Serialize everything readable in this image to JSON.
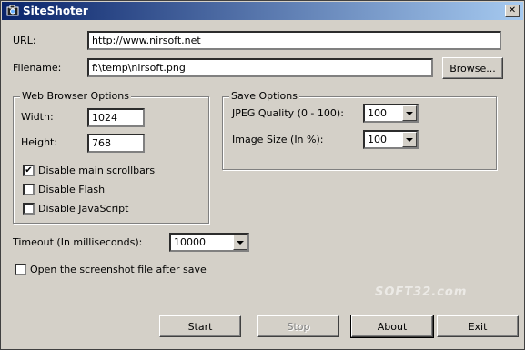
{
  "window": {
    "title": "SiteShoter",
    "close_glyph": "✕"
  },
  "url": {
    "label": "URL:",
    "value": "http://www.nirsoft.net"
  },
  "filename": {
    "label": "Filename:",
    "value": "f:\\temp\\nirsoft.png",
    "browse_label": "Browse..."
  },
  "web_browser_options": {
    "title": "Web Browser Options",
    "width_label": "Width:",
    "width_value": "1024",
    "height_label": "Height:",
    "height_value": "768",
    "checkboxes": [
      {
        "label": "Disable main scrollbars",
        "checked": true,
        "mark": "✔"
      },
      {
        "label": "Disable Flash",
        "checked": false,
        "mark": ""
      },
      {
        "label": "Disable JavaScript",
        "checked": false,
        "mark": ""
      }
    ]
  },
  "save_options": {
    "title": "Save Options",
    "jpeg_quality_label": "JPEG Quality (0 - 100):",
    "jpeg_quality_value": "100",
    "image_size_label": "Image Size (In %):",
    "image_size_value": "100"
  },
  "timeout": {
    "label": "Timeout (In milliseconds):",
    "value": "10000"
  },
  "open_after_save": {
    "label": "Open the screenshot file after save",
    "checked": false,
    "mark": ""
  },
  "buttons": {
    "start": "Start",
    "stop": "Stop",
    "about": "About",
    "exit": "Exit"
  },
  "watermark": "SOFT32.com"
}
